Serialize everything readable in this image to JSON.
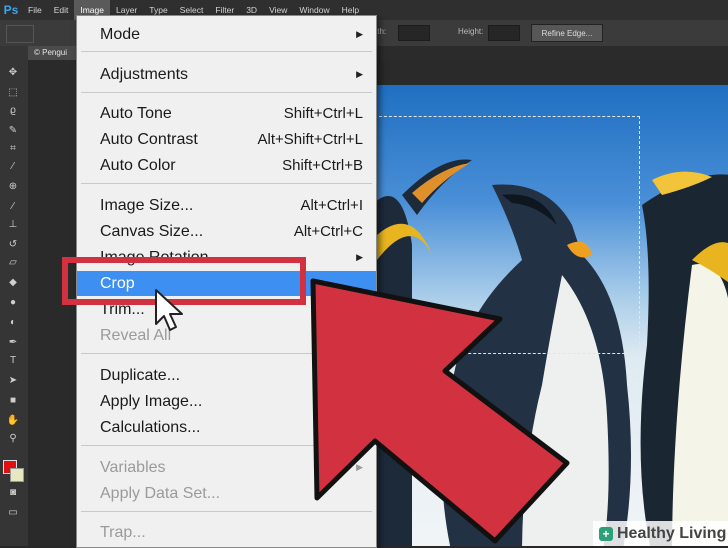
{
  "menubar": {
    "app_logo": "Ps",
    "items": [
      "File",
      "Edit",
      "Image",
      "Layer",
      "Type",
      "Select",
      "Filter",
      "3D",
      "View",
      "Window",
      "Help"
    ]
  },
  "options_bar": {
    "width_label": "idth:",
    "height_label": "Height:",
    "refine_edge": "Refine Edge..."
  },
  "document_tab": "© Pengui",
  "image_menu": {
    "items": [
      {
        "label": "Mode",
        "shortcut": "",
        "submenu": true,
        "disabled": false
      },
      {
        "label": "Adjustments",
        "shortcut": "",
        "submenu": true,
        "disabled": false
      },
      {
        "label": "Auto Tone",
        "shortcut": "Shift+Ctrl+L",
        "submenu": false,
        "disabled": false
      },
      {
        "label": "Auto Contrast",
        "shortcut": "Alt+Shift+Ctrl+L",
        "submenu": false,
        "disabled": false
      },
      {
        "label": "Auto Color",
        "shortcut": "Shift+Ctrl+B",
        "submenu": false,
        "disabled": false
      },
      {
        "label": "Image Size...",
        "shortcut": "Alt+Ctrl+I",
        "submenu": false,
        "disabled": false
      },
      {
        "label": "Canvas Size...",
        "shortcut": "Alt+Ctrl+C",
        "submenu": false,
        "disabled": false
      },
      {
        "label": "Image Rotation",
        "shortcut": "",
        "submenu": true,
        "disabled": false
      },
      {
        "label": "Crop",
        "shortcut": "",
        "submenu": false,
        "disabled": false,
        "highlighted": true
      },
      {
        "label": "Trim...",
        "shortcut": "",
        "submenu": false,
        "disabled": false
      },
      {
        "label": "Reveal All",
        "shortcut": "",
        "submenu": false,
        "disabled": true
      },
      {
        "label": "Duplicate...",
        "shortcut": "",
        "submenu": false,
        "disabled": false
      },
      {
        "label": "Apply Image...",
        "shortcut": "",
        "submenu": false,
        "disabled": false
      },
      {
        "label": "Calculations...",
        "shortcut": "",
        "submenu": false,
        "disabled": false
      },
      {
        "label": "Variables",
        "shortcut": "",
        "submenu": true,
        "disabled": true
      },
      {
        "label": "Apply Data Set...",
        "shortcut": "",
        "submenu": false,
        "disabled": true
      },
      {
        "label": "Trap...",
        "shortcut": "",
        "submenu": false,
        "disabled": true
      }
    ]
  },
  "watermark": "Healthy Living",
  "colors": {
    "highlight": "#3d8ff2",
    "annotation_red": "#d2323f",
    "foreground_swatch": "#e01010",
    "background_swatch": "#e8e8c0"
  }
}
